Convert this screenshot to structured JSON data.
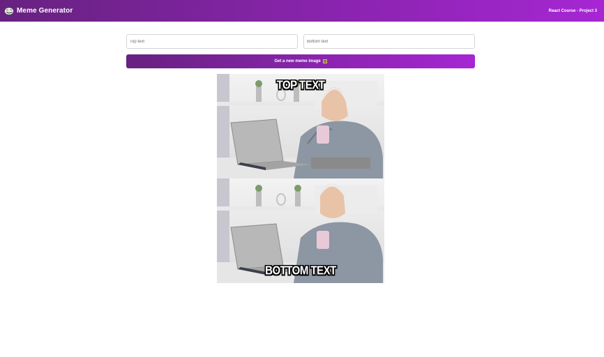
{
  "header": {
    "title": "Meme Generator",
    "course": "React Course - Project 3",
    "logo_icon": "troll-face-icon",
    "gradient": [
      "#672280",
      "#A626D3"
    ]
  },
  "form": {
    "top_text": {
      "value": "",
      "placeholder": "Top text"
    },
    "bottom_text": {
      "value": "",
      "placeholder": "Bottom text"
    },
    "button_label": "Get a new meme image",
    "button_icon": "framed-picture-icon"
  },
  "meme": {
    "top_text": "TOP TEXT",
    "bottom_text": "BOTTOM TEXT",
    "image": "hide-the-pain-harold"
  }
}
